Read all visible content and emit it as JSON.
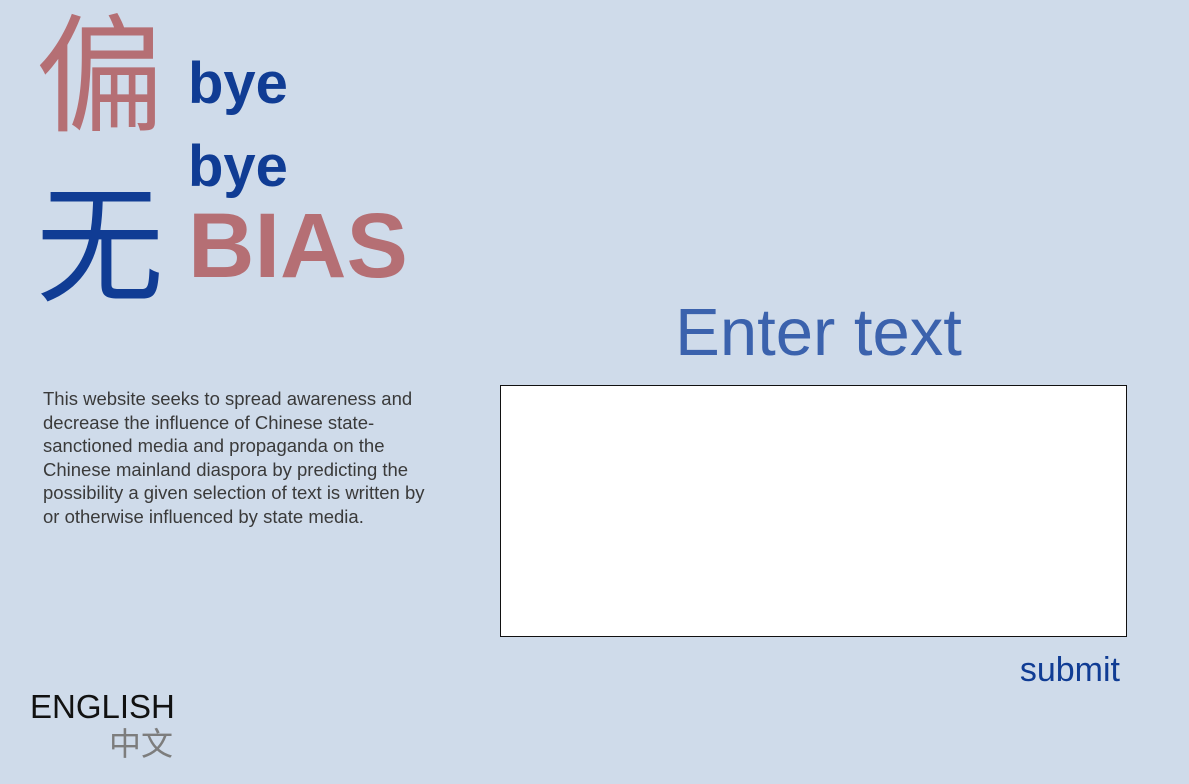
{
  "logo": {
    "char_top": "偏",
    "char_bottom": "无",
    "word_1": "bye",
    "word_2": "bye",
    "word_3": "BIAS"
  },
  "description": "This website seeks to spread awareness and decrease the influence of Chinese state-sanctioned media and propaganda on the Chinese mainland diaspora by predicting the possibility a given selection of text is written by or otherwise influenced by state media.",
  "input": {
    "heading": "Enter text",
    "value": "",
    "placeholder": ""
  },
  "submit_label": "submit",
  "language": {
    "english": "ENGLISH",
    "chinese": "中文"
  },
  "colors": {
    "background": "#cfdbea",
    "brand_red": "#b56f74",
    "brand_blue": "#103c94",
    "heading_blue": "#3b62ad"
  }
}
